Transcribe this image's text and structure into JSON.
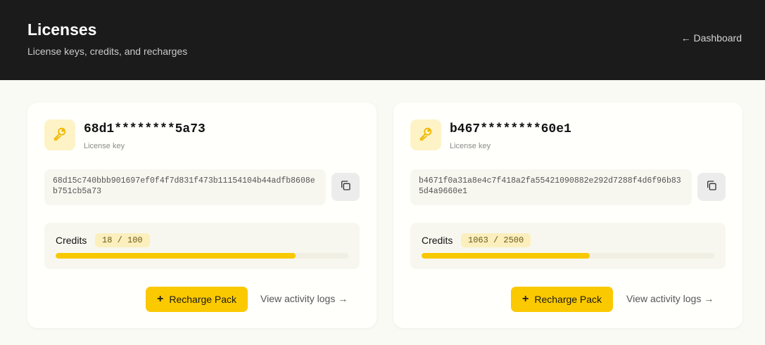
{
  "header": {
    "title": "Licenses",
    "subtitle": "License keys, credits, and recharges",
    "back_link": "← Dashboard"
  },
  "colors": {
    "header_bg": "#1b1b1b",
    "accent": "#fbc900",
    "key_tile_bg": "#fdf3c7",
    "key_icon": "#f0b800"
  },
  "licenses": [
    {
      "masked_key": "68d1********5a73",
      "key_label": "License key",
      "full_key": "68d15c740bbb901697ef0f4f7d831f473b11154104b44adfb8608eb751cb5a73",
      "credits_label": "Credits",
      "credits_text": "18 / 100",
      "credits_used_fraction": 0.82,
      "recharge_label": "Recharge Pack",
      "activity_label": "View activity logs →",
      "icons": {
        "key": "key-icon",
        "copy": "copy-icon",
        "plus": "plus-icon"
      }
    },
    {
      "masked_key": "b467********60e1",
      "key_label": "License key",
      "full_key": "b4671f0a31a8e4c7f418a2fa55421090882e292d7288f4d6f96b835d4a9660e1",
      "credits_label": "Credits",
      "credits_text": "1063 / 2500",
      "credits_used_fraction": 0.575,
      "recharge_label": "Recharge Pack",
      "activity_label": "View activity logs →",
      "icons": {
        "key": "key-icon",
        "copy": "copy-icon",
        "plus": "plus-icon"
      }
    }
  ]
}
